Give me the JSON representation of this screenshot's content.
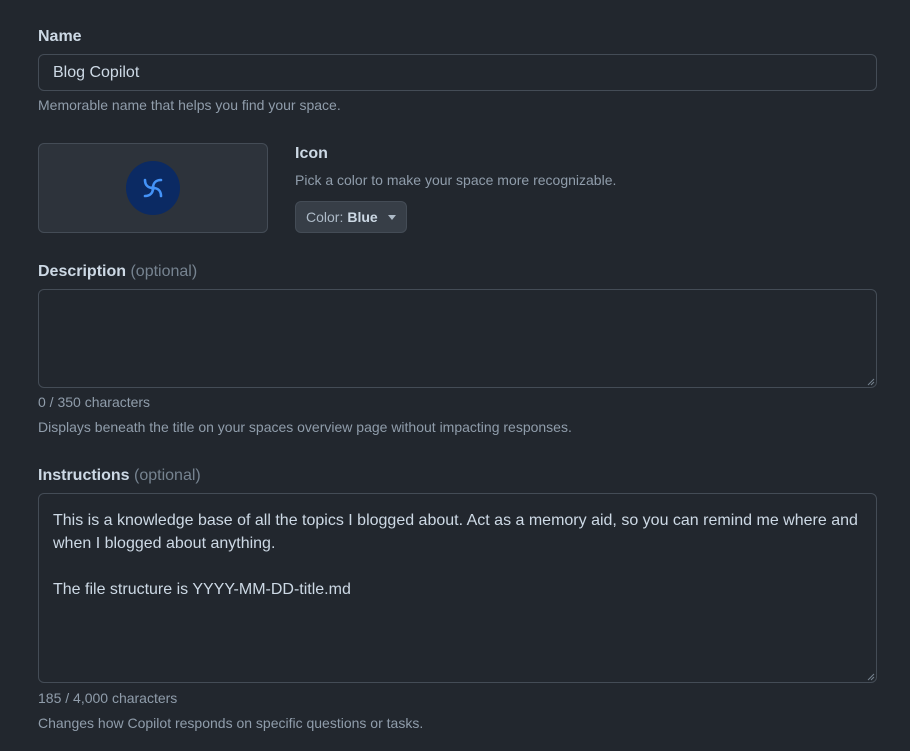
{
  "name": {
    "label": "Name",
    "value": "Blog Copilot",
    "hint": "Memorable name that helps you find your space."
  },
  "icon": {
    "label": "Icon",
    "hint": "Pick a color to make your space more recognizable.",
    "color_prefix": "Color:",
    "color_value": "Blue",
    "avatar_icon": "copilot-spiral-icon",
    "avatar_bg": "#0b2a63",
    "avatar_fg": "#4493f8"
  },
  "description": {
    "label": "Description",
    "optional": "(optional)",
    "value": "",
    "counter": "0 / 350 characters",
    "hint": "Displays beneath the title on your spaces overview page without impacting responses."
  },
  "instructions": {
    "label": "Instructions",
    "optional": "(optional)",
    "value": "This is a knowledge base of all the topics I blogged about. Act as a memory aid, so you can remind me where and when I blogged about anything.\n\nThe file structure is YYYY-MM-DD-title.md",
    "counter": "185 / 4,000 characters",
    "hint": "Changes how Copilot responds on specific questions or tasks."
  }
}
